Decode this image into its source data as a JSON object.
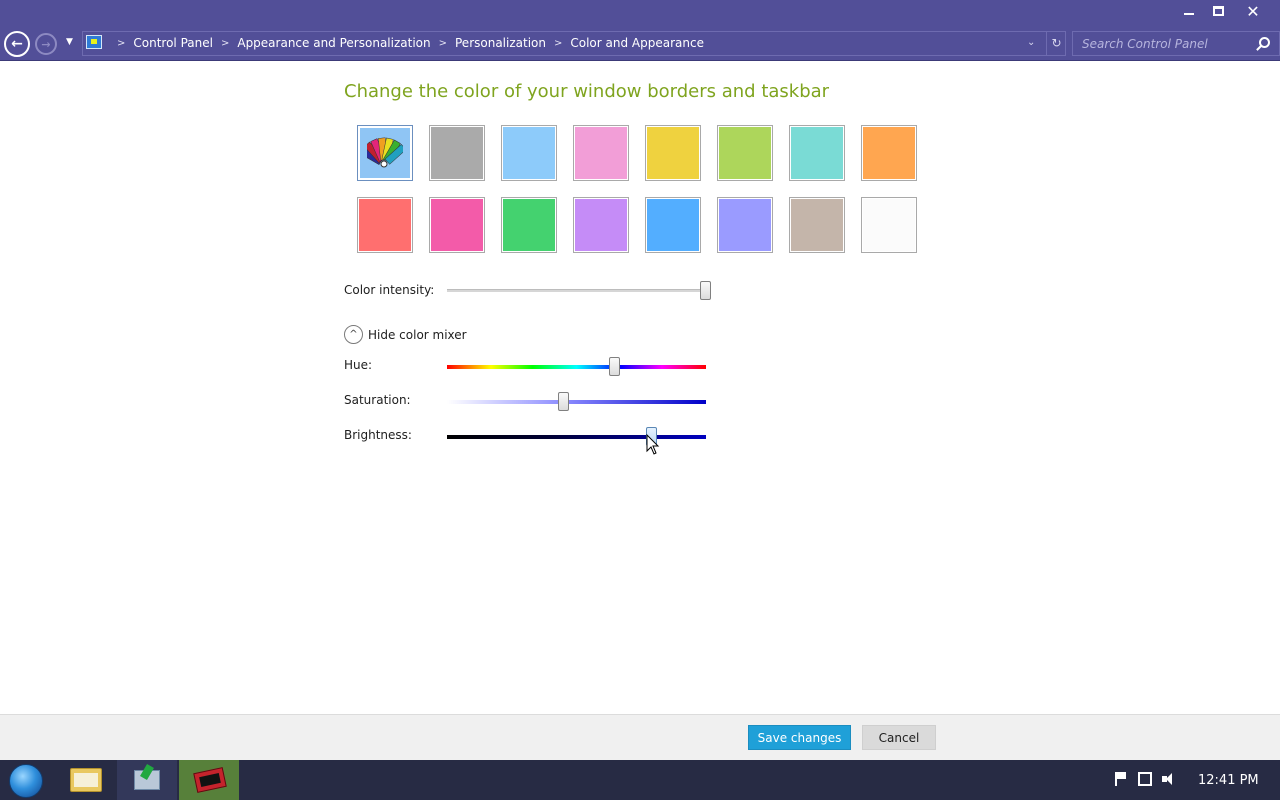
{
  "window": {
    "minimize_icon": "minimize-icon",
    "maximize_icon": "restore-icon",
    "close_icon": "close-icon",
    "accent": "#524f98"
  },
  "nav": {
    "breadcrumbs": [
      "Control Panel",
      "Appearance and Personalization",
      "Personalization",
      "Color and Appearance"
    ],
    "search_placeholder": "Search Control Panel"
  },
  "page": {
    "title": "Change the color of your window borders and taskbar",
    "title_color": "#7fa41f",
    "swatches": [
      {
        "name": "custom-color-swatch",
        "color": "#8fc5f4",
        "selected": true
      },
      {
        "name": "gray-swatch",
        "color": "#aaaaaa"
      },
      {
        "name": "sky-blue-swatch",
        "color": "#8dcbfa"
      },
      {
        "name": "pink-swatch",
        "color": "#f29ed7"
      },
      {
        "name": "yellow-swatch",
        "color": "#efd23f"
      },
      {
        "name": "lime-swatch",
        "color": "#add65b"
      },
      {
        "name": "teal-swatch",
        "color": "#7adbd5"
      },
      {
        "name": "orange-swatch",
        "color": "#ffa650"
      },
      {
        "name": "red-swatch",
        "color": "#ff6f6f"
      },
      {
        "name": "magenta-swatch",
        "color": "#f35ba9"
      },
      {
        "name": "green-swatch",
        "color": "#44d26f"
      },
      {
        "name": "violet-swatch",
        "color": "#c58cf7"
      },
      {
        "name": "blue-swatch",
        "color": "#53aeff"
      },
      {
        "name": "periwinkle-swatch",
        "color": "#9a9bff"
      },
      {
        "name": "taupe-swatch",
        "color": "#c4b5aa"
      },
      {
        "name": "white-swatch",
        "color": "#fbfbfb"
      }
    ],
    "intensity_label": "Color intensity:",
    "intensity_value": 1.0,
    "mixer_toggle_label": "Hide color mixer",
    "hue_label": "Hue:",
    "hue_value": 0.65,
    "saturation_label": "Saturation:",
    "saturation_value": 0.45,
    "brightness_label": "Brightness:",
    "brightness_value": 0.79
  },
  "footer": {
    "save_label": "Save changes",
    "cancel_label": "Cancel"
  },
  "taskbar": {
    "clock": "12:41 PM",
    "items": [
      "file-explorer-icon",
      "installer-icon",
      "app-icon"
    ]
  }
}
